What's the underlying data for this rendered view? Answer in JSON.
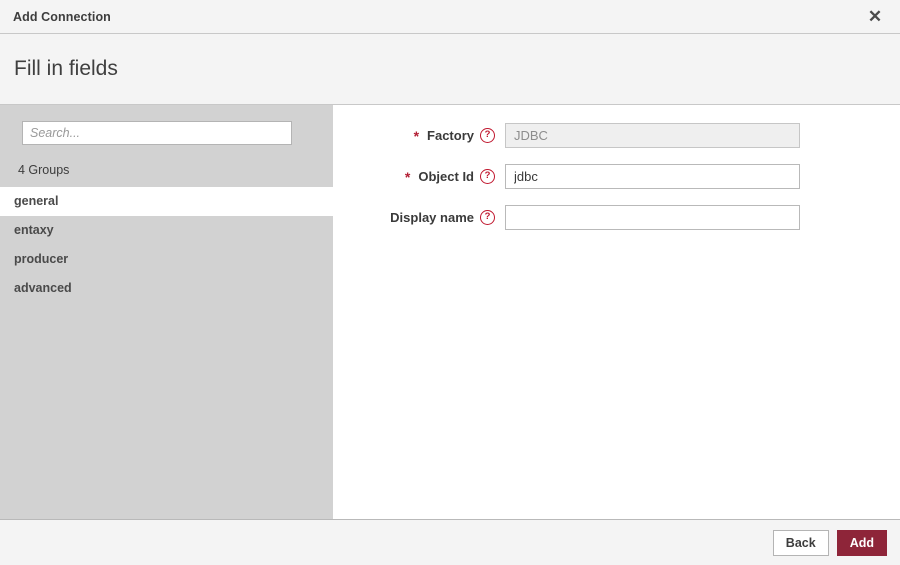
{
  "window": {
    "title": "Add Connection",
    "close_icon": "close-icon",
    "close_glyph": "✕"
  },
  "header": {
    "title": "Fill in fields"
  },
  "sidebar": {
    "search": {
      "placeholder": "Search...",
      "value": ""
    },
    "groups_count_label": "4 Groups",
    "items": [
      {
        "label": "general",
        "selected": true
      },
      {
        "label": "entaxy",
        "selected": false
      },
      {
        "label": "producer",
        "selected": false
      },
      {
        "label": "advanced",
        "selected": false
      }
    ]
  },
  "form": {
    "help_glyph": "?",
    "required_marker": "*",
    "fields": [
      {
        "label": "Factory",
        "required": true,
        "value": "JDBC",
        "placeholder": "",
        "disabled": true
      },
      {
        "label": "Object Id",
        "required": true,
        "value": "jdbc",
        "placeholder": "",
        "disabled": false
      },
      {
        "label": "Display name",
        "required": false,
        "value": "",
        "placeholder": "",
        "disabled": false
      }
    ]
  },
  "footer": {
    "back_label": "Back",
    "add_label": "Add"
  },
  "colors": {
    "primary": "#8e2539",
    "required_star": "#b32035",
    "help_icon": "#c0182f",
    "sidebar_bg": "#d2d2d2",
    "chrome_bg": "#f4f4f4"
  }
}
